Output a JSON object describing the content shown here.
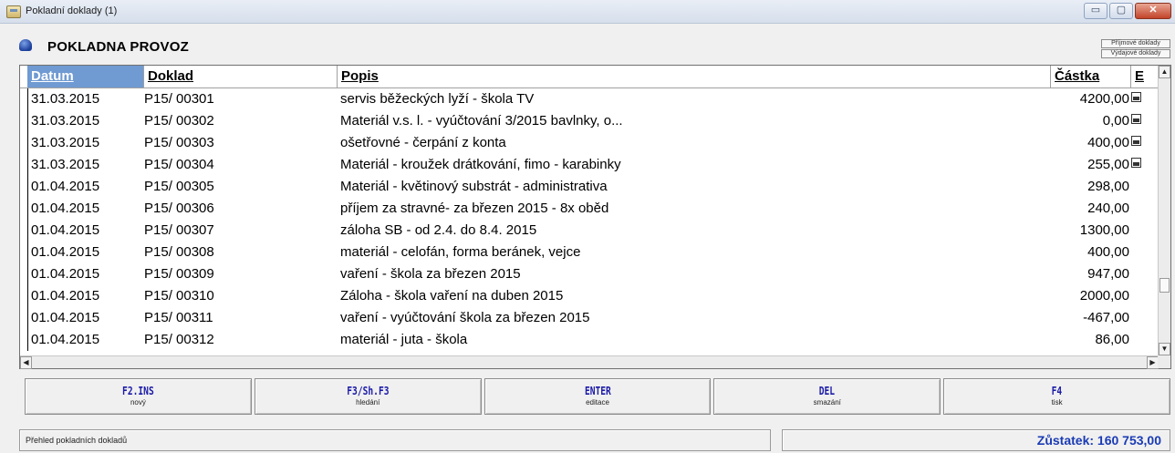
{
  "window": {
    "title": "Pokladní doklady (1)",
    "buttons": {
      "minimize": "▭",
      "maximize": "▢",
      "close": "✕"
    }
  },
  "header": {
    "title": "POKLADNA PROVOZ",
    "icon": "cash-register-icon",
    "mini_buttons": [
      "Příjmové doklady",
      "Výdajové doklady"
    ]
  },
  "table": {
    "columns": [
      "Datum",
      "Doklad",
      "Popis",
      "Částka",
      "E"
    ],
    "active_column": "Datum",
    "rows": [
      {
        "datum": "31.03.2015",
        "doklad": "P15/ 00301",
        "popis": "servis běžeckých lyží - škola TV",
        "castka": "4200,00",
        "exported": true
      },
      {
        "datum": "31.03.2015",
        "doklad": "P15/ 00302",
        "popis": "Materiál v.s. l. - vyúčtování 3/2015 bavlnky, o...",
        "castka": "0,00",
        "exported": true
      },
      {
        "datum": "31.03.2015",
        "doklad": "P15/ 00303",
        "popis": "ošetřovné - čerpání z konta",
        "castka": "400,00",
        "exported": true
      },
      {
        "datum": "31.03.2015",
        "doklad": "P15/ 00304",
        "popis": "Materiál - kroužek drátkování, fimo - karabinky",
        "castka": "255,00",
        "exported": true
      },
      {
        "datum": "01.04.2015",
        "doklad": "P15/ 00305",
        "popis": "Materiál - květinový substrát - administrativa",
        "castka": "298,00",
        "exported": false
      },
      {
        "datum": "01.04.2015",
        "doklad": "P15/ 00306",
        "popis": "příjem za stravné-  za březen 2015 - 8x oběd",
        "castka": "240,00",
        "exported": false
      },
      {
        "datum": "01.04.2015",
        "doklad": "P15/ 00307",
        "popis": "záloha SB - od 2.4. do  8.4. 2015",
        "castka": "1300,00",
        "exported": false
      },
      {
        "datum": "01.04.2015",
        "doklad": "P15/ 00308",
        "popis": "materiál - celofán, forma beránek, vejce",
        "castka": "400,00",
        "exported": false
      },
      {
        "datum": "01.04.2015",
        "doklad": "P15/ 00309",
        "popis": "vaření - škola za březen 2015",
        "castka": "947,00",
        "exported": false
      },
      {
        "datum": "01.04.2015",
        "doklad": "P15/ 00310",
        "popis": "Záloha - škola vaření  na duben 2015",
        "castka": "2000,00",
        "exported": false
      },
      {
        "datum": "01.04.2015",
        "doklad": "P15/ 00311",
        "popis": "vaření - vyúčtování škola za březen 2015",
        "castka": "-467,00",
        "exported": false
      },
      {
        "datum": "01.04.2015",
        "doklad": "P15/ 00312",
        "popis": "materiál - juta - škola",
        "castka": "86,00",
        "exported": false
      }
    ]
  },
  "function_buttons": [
    {
      "key": "F2.INS",
      "label": "nový"
    },
    {
      "key": "F3/Sh.F3",
      "label": "hledání"
    },
    {
      "key": "ENTER",
      "label": "editace"
    },
    {
      "key": "DEL",
      "label": "smazání"
    },
    {
      "key": "F4",
      "label": "tisk"
    }
  ],
  "status": {
    "left": "Přehled pokladních dokladů",
    "balance": "Zůstatek: 160 753,00"
  },
  "colors": {
    "active_header": "#6f9ad2",
    "function_key": "#1a1aa8",
    "balance": "#1a3bb5"
  }
}
